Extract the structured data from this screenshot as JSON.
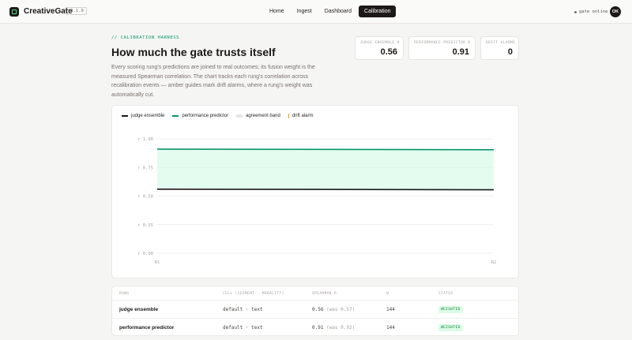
{
  "app": {
    "brand": "CreativeGate",
    "version": "v0.1.0",
    "status": "gate online",
    "avatar": "OK"
  },
  "nav": {
    "items": [
      "Home",
      "Ingest",
      "Dashboard",
      "Calibration"
    ],
    "active": "Calibration"
  },
  "header": {
    "eyebrow": "// CALIBRATION HARNESS",
    "title": "How much the gate trusts itself",
    "description": "Every scoring rung's predictions are joined to real outcomes; its fusion weight is the measured Spearman correlation. The chart tracks each rung's correlation across recalibration events — amber guides mark drift alarms, where a rung's weight was automatically cut."
  },
  "stats": [
    {
      "label": "JUDGE ENSEMBLE R",
      "value": "0.56"
    },
    {
      "label": "PERFORMANCE PREDICTOR R",
      "value": "0.91"
    },
    {
      "label": "DRIFT ALARMS",
      "value": "0"
    }
  ],
  "chart_data": {
    "type": "line",
    "x": [
      "R1",
      "R2"
    ],
    "series": [
      {
        "name": "judge ensemble",
        "values": [
          0.56,
          0.555
        ],
        "color": "#1c1917"
      },
      {
        "name": "performance predictor",
        "values": [
          0.91,
          0.905
        ],
        "color": "#059669"
      }
    ],
    "band": {
      "name": "agreement band",
      "color": "#d1fae5"
    },
    "drift": {
      "name": "drift alarm",
      "color": "#f59e0b",
      "events": []
    },
    "y_ticks": [
      {
        "value": 1.0,
        "label": "r 1.00"
      },
      {
        "value": 0.75,
        "label": "r 0.75"
      },
      {
        "value": 0.5,
        "label": "r 0.50"
      },
      {
        "value": 0.25,
        "label": "r 0.25"
      },
      {
        "value": 0.0,
        "label": "r 0.00"
      }
    ],
    "ylim": [
      0,
      1
    ],
    "grid": true,
    "legend": "top-left"
  },
  "table": {
    "headers": [
      "RUNG",
      "CELL (SEGMENT · MODALITY)",
      "SPEARMAN R",
      "N",
      "STATUS"
    ],
    "rows": [
      {
        "rung": "judge ensemble",
        "cell": "default · text",
        "spearman": "0.56",
        "was": "(was 0.57)",
        "n": "144",
        "status": "WEIGHTED"
      },
      {
        "rung": "performance predictor",
        "cell": "default · text",
        "spearman": "0.91",
        "was": "(was 0.92)",
        "n": "144",
        "status": "WEIGHTED"
      }
    ]
  }
}
